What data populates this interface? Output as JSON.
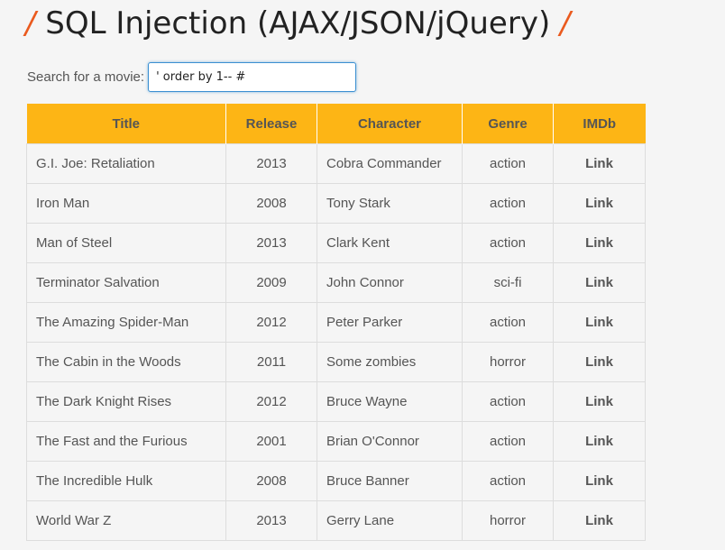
{
  "page": {
    "slash": "/",
    "title": "SQL Injection (AJAX/JSON/jQuery)"
  },
  "search": {
    "label": "Search for a movie:",
    "value": "' order by 1-- #"
  },
  "table": {
    "headers": [
      "Title",
      "Release",
      "Character",
      "Genre",
      "IMDb"
    ],
    "rows": [
      {
        "title": "G.I. Joe: Retaliation",
        "release": "2013",
        "character": "Cobra Commander",
        "genre": "action",
        "imdb": "Link"
      },
      {
        "title": "Iron Man",
        "release": "2008",
        "character": "Tony Stark",
        "genre": "action",
        "imdb": "Link"
      },
      {
        "title": "Man of Steel",
        "release": "2013",
        "character": "Clark Kent",
        "genre": "action",
        "imdb": "Link"
      },
      {
        "title": "Terminator Salvation",
        "release": "2009",
        "character": "John Connor",
        "genre": "sci-fi",
        "imdb": "Link"
      },
      {
        "title": "The Amazing Spider-Man",
        "release": "2012",
        "character": "Peter Parker",
        "genre": "action",
        "imdb": "Link"
      },
      {
        "title": "The Cabin in the Woods",
        "release": "2011",
        "character": "Some zombies",
        "genre": "horror",
        "imdb": "Link"
      },
      {
        "title": "The Dark Knight Rises",
        "release": "2012",
        "character": "Bruce Wayne",
        "genre": "action",
        "imdb": "Link"
      },
      {
        "title": "The Fast and the Furious",
        "release": "2001",
        "character": "Brian O'Connor",
        "genre": "action",
        "imdb": "Link"
      },
      {
        "title": "The Incredible Hulk",
        "release": "2008",
        "character": "Bruce Banner",
        "genre": "action",
        "imdb": "Link"
      },
      {
        "title": "World War Z",
        "release": "2013",
        "character": "Gerry Lane",
        "genre": "horror",
        "imdb": "Link"
      }
    ]
  },
  "colors": {
    "accent": "#fdb515",
    "slash": "#ea5a1e",
    "text": "#555555"
  }
}
